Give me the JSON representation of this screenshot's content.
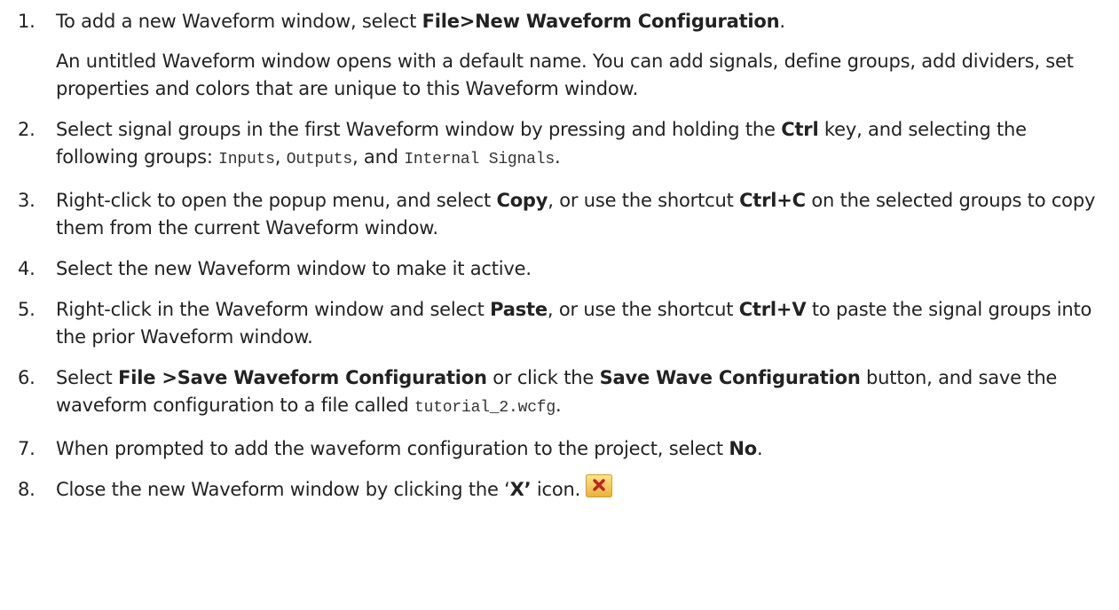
{
  "steps": [
    {
      "num": "1.",
      "p1": "To add a new Waveform window, select ",
      "b1": "File>New Waveform Configuration",
      "p2": ".",
      "sub": "An untitled Waveform window opens with a default name. You can add signals, define groups, add dividers, set properties and colors that are unique to this Waveform window."
    },
    {
      "num": "2.",
      "p1": "Select signal groups in the first Waveform window by pressing and holding the ",
      "b1": "Ctrl",
      "p2": " key, and selecting the following groups: ",
      "c1": "Inputs",
      "p3": ", ",
      "c2": "Outputs",
      "p4": ", and ",
      "c3": "Internal Signals",
      "p5": "."
    },
    {
      "num": "3.",
      "p1": "Right-click to open the popup menu, and select ",
      "b1": "Copy",
      "p2": ", or use the shortcut ",
      "b2": "Ctrl+C",
      "p3": " on the selected groups to copy them from the current Waveform window."
    },
    {
      "num": "4.",
      "p1": "Select the new Waveform window to make it active."
    },
    {
      "num": "5.",
      "p1": "Right-click in the Waveform window and select ",
      "b1": "Paste",
      "p2": ", or use the shortcut ",
      "b2": "Ctrl+V",
      "p3": " to paste the signal groups into the prior Waveform window."
    },
    {
      "num": "6.",
      "p1": "Select ",
      "b1": "File >Save Waveform Configuration",
      "p2": " or click the ",
      "b2": "Save Wave Configuration",
      "p3": " button, and save the waveform configuration to a file called ",
      "c1": "tutorial_2.wcfg",
      "p4": "."
    },
    {
      "num": "7.",
      "p1": "When prompted to add the waveform configuration to the project, select ",
      "b1": "No",
      "p2": "."
    },
    {
      "num": "8.",
      "p1": "Close the new Waveform window by clicking the ‘",
      "b1": "X’",
      "p2": " icon.",
      "icon": "close-icon",
      "colors": {
        "icon_bg_top": "#fbe58a",
        "icon_bg_bottom": "#e9b13a",
        "icon_x": "#c0241f"
      }
    }
  ]
}
